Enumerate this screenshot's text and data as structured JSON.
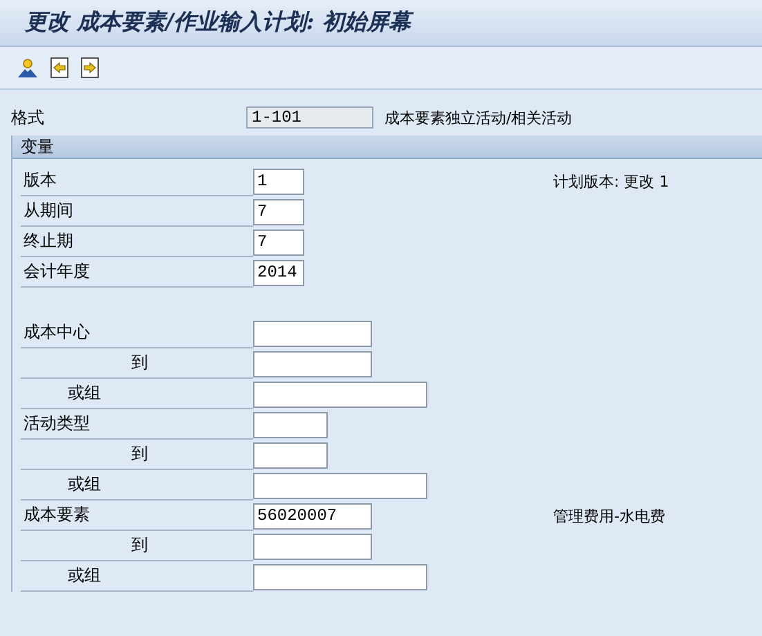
{
  "window": {
    "title": "更改 成本要素/作业输入计划: 初始屏幕"
  },
  "toolbar": {
    "buttons": [
      {
        "kind": "person"
      },
      {
        "kind": "back"
      },
      {
        "kind": "forward"
      }
    ]
  },
  "layout_row": {
    "label": "格式",
    "value": "1-101",
    "description": "成本要素独立活动/相关活动"
  },
  "section": {
    "title": "变量",
    "blocks": [
      {
        "rows": [
          {
            "label": "版本",
            "value": "1",
            "kind": "tiny",
            "note": "计划版本: 更改 1"
          },
          {
            "label": "从期间",
            "value": "7",
            "kind": "tiny"
          },
          {
            "label": "终止期",
            "value": "7",
            "kind": "tiny"
          },
          {
            "label": "会计年度",
            "value": "2014",
            "kind": "tiny"
          }
        ]
      },
      {
        "rows": [
          {
            "label": "成本中心",
            "kind": "medium",
            "to": {
              "label": "到",
              "kind": "medium"
            },
            "group": {
              "label": "或组",
              "kind": "wide"
            }
          },
          {
            "label": "活动类型",
            "kind": "short",
            "to": {
              "label": "到",
              "kind": "short"
            },
            "group": {
              "label": "或组",
              "kind": "wide"
            }
          },
          {
            "label": "成本要素",
            "value": "56020007",
            "kind": "medium",
            "note": "管理费用-水电费",
            "to": {
              "label": "到",
              "kind": "medium"
            },
            "group": {
              "label": "或组",
              "kind": "wide"
            }
          }
        ]
      }
    ]
  }
}
